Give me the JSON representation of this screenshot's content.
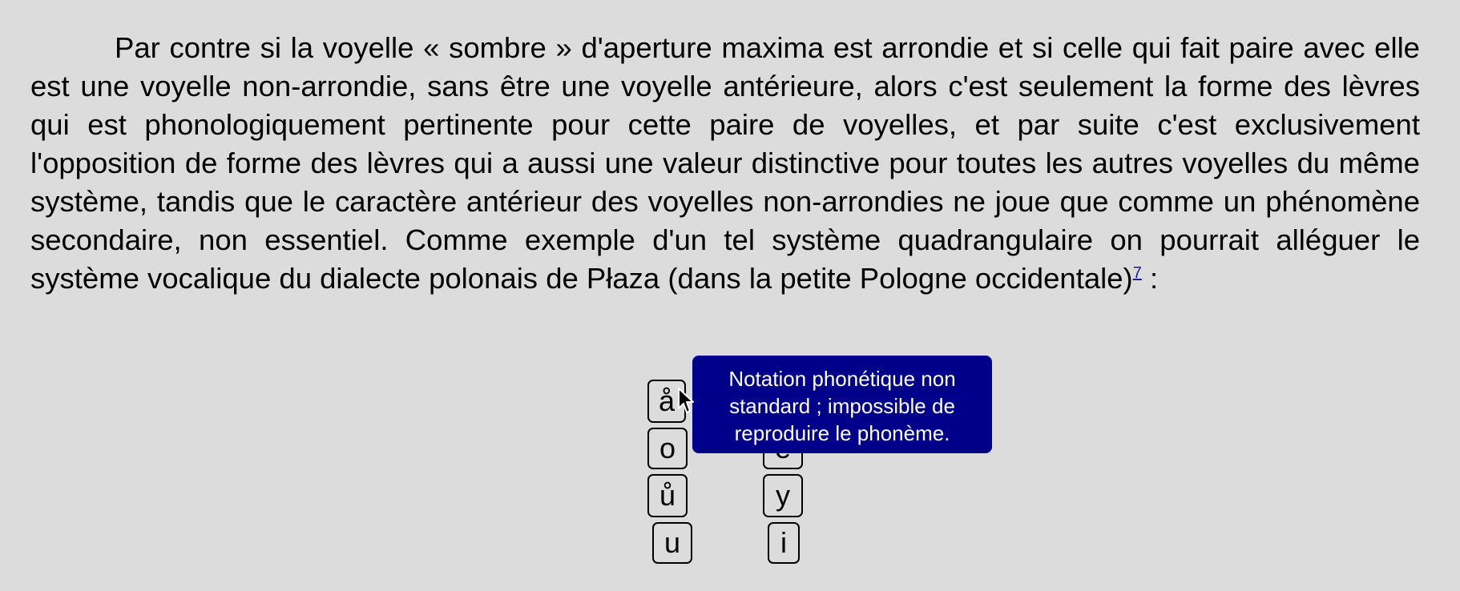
{
  "paragraph": {
    "text": "Par contre si la voyelle « sombre » d'aperture maxima est arrondie et si celle qui fait paire avec elle est une voyelle non-arrondie, sans être une voyelle antérieure, alors c'est seulement la forme des lèvres qui est phonologiquement pertinente pour cette paire de voyelles, et par suite c'est exclusivement l'opposition de forme des lèvres qui a aussi une valeur distinctive pour toutes les autres voyelles du même système, tandis que le caractère antérieur des voyelles non-arrondies ne joue que comme un phénomène secondaire, non essentiel. Comme exemple d'un tel système quadrangulaire on pourrait alléguer le système vocalique du dialecte polonais de Płaza (dans la petite Pologne occidentale)",
    "footnote": "7",
    "after_footnote": " :"
  },
  "vowels": {
    "left": [
      "å",
      "o",
      "ů",
      "u"
    ],
    "right": [
      "e",
      "y",
      "i"
    ]
  },
  "tooltip": {
    "text": "Notation phonétique non standard ; impossible de reproduire le phonème."
  },
  "colors": {
    "background": "#dcdcdc",
    "tooltip_bg": "#00008b",
    "link": "#1a1aa6"
  }
}
